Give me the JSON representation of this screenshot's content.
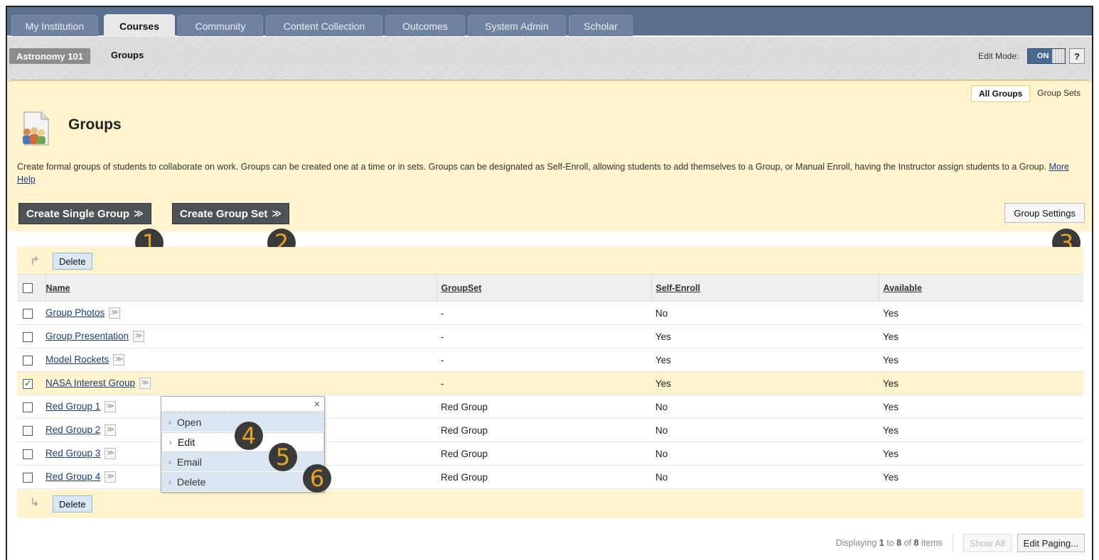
{
  "tabs": [
    {
      "label": "My Institution",
      "active": false
    },
    {
      "label": "Courses",
      "active": true
    },
    {
      "label": "Community",
      "active": false
    },
    {
      "label": "Content Collection",
      "active": false
    },
    {
      "label": "Outcomes",
      "active": false
    },
    {
      "label": "System Admin",
      "active": false
    },
    {
      "label": "Scholar",
      "active": false
    }
  ],
  "breadcrumb": {
    "course": "Astronomy 101",
    "current": "Groups"
  },
  "edit_mode": {
    "label": "Edit Mode:",
    "state": "ON",
    "help": "?"
  },
  "view_tabs": {
    "all_groups": "All Groups",
    "group_sets": "Group Sets"
  },
  "page": {
    "title": "Groups",
    "description": "Create formal groups of students to collaborate on work. Groups can be created one at a time or in sets. Groups can be designated as Self-Enroll, allowing students to add themselves to a Group, or Manual Enroll, having the Instructor assign students to a Group.",
    "more_help": "More Help"
  },
  "actions": {
    "create_single": "Create Single Group",
    "create_set": "Create Group Set",
    "settings": "Group Settings",
    "delete": "Delete"
  },
  "callouts": [
    "1",
    "2",
    "3",
    "4",
    "5",
    "6"
  ],
  "table": {
    "headers": [
      "Name",
      "GroupSet",
      "Self-Enroll",
      "Available"
    ],
    "rows": [
      {
        "name": "Group Photos",
        "groupset": "-",
        "self_enroll": "No",
        "available": "Yes",
        "checked": false
      },
      {
        "name": "Group Presentation",
        "groupset": "-",
        "self_enroll": "Yes",
        "available": "Yes",
        "checked": false
      },
      {
        "name": "Model Rockets",
        "groupset": "-",
        "self_enroll": "Yes",
        "available": "Yes",
        "checked": false
      },
      {
        "name": "NASA Interest Group",
        "groupset": "-",
        "self_enroll": "Yes",
        "available": "Yes",
        "checked": true
      },
      {
        "name": "Red Group 1",
        "groupset": "Red Group",
        "self_enroll": "No",
        "available": "Yes",
        "checked": false
      },
      {
        "name": "Red Group 2",
        "groupset": "Red Group",
        "self_enroll": "No",
        "available": "Yes",
        "checked": false
      },
      {
        "name": "Red Group 3",
        "groupset": "Red Group",
        "self_enroll": "No",
        "available": "Yes",
        "checked": false
      },
      {
        "name": "Red Group 4",
        "groupset": "Red Group",
        "self_enroll": "No",
        "available": "Yes",
        "checked": false
      }
    ]
  },
  "context_menu": {
    "close": "×",
    "items": [
      "Open",
      "Edit",
      "Email",
      "Delete"
    ]
  },
  "paging": {
    "prefix": "Displaying",
    "from": "1",
    "to_word": "to",
    "to": "8",
    "of_word": "of",
    "total": "8",
    "suffix": "items",
    "show_all": "Show All",
    "edit_paging": "Edit Paging..."
  }
}
